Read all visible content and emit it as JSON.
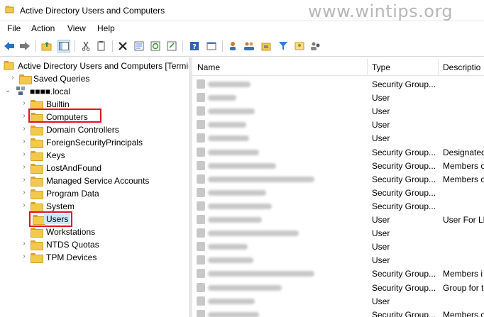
{
  "window": {
    "title": "Active Directory Users and Computers"
  },
  "watermark": "www.wintips.org",
  "menu": [
    "File",
    "Action",
    "View",
    "Help"
  ],
  "toolbar": {
    "icons": [
      "back-icon",
      "forward-icon",
      "up-folder-icon",
      "show-console-tree-icon",
      "cut-icon",
      "copy-icon",
      "delete-icon",
      "properties-icon",
      "refresh-icon",
      "export-list-icon",
      "help-icon",
      "mmc-console-icon",
      "new-user-icon",
      "new-group-icon",
      "new-ou-icon",
      "filter-icon",
      "add-to-group-icon",
      "delegate-control-icon"
    ]
  },
  "tree": {
    "root": "Active Directory Users and Computers [Termi",
    "saved_queries": "Saved Queries",
    "domain": "■■■■.local",
    "children": [
      {
        "label": "Builtin"
      },
      {
        "label": "Computers",
        "highlighted": true
      },
      {
        "label": "Domain Controllers"
      },
      {
        "label": "ForeignSecurityPrincipals"
      },
      {
        "label": "Keys"
      },
      {
        "label": "LostAndFound"
      },
      {
        "label": "Managed Service Accounts"
      },
      {
        "label": "Program Data"
      },
      {
        "label": "System"
      },
      {
        "label": "Users",
        "highlighted": true,
        "selected": true
      },
      {
        "label": "Workstations"
      },
      {
        "label": "NTDS Quotas"
      },
      {
        "label": "TPM Devices"
      }
    ]
  },
  "list": {
    "columns": [
      "Name",
      "Type",
      "Descriptio"
    ],
    "rows": [
      {
        "type": "Security Group...",
        "desc": ""
      },
      {
        "type": "User",
        "desc": ""
      },
      {
        "type": "User",
        "desc": ""
      },
      {
        "type": "User",
        "desc": ""
      },
      {
        "type": "User",
        "desc": ""
      },
      {
        "type": "Security Group...",
        "desc": "Designated"
      },
      {
        "type": "Security Group...",
        "desc": "Members o"
      },
      {
        "type": "Security Group...",
        "desc": "Members o"
      },
      {
        "type": "Security Group...",
        "desc": ""
      },
      {
        "type": "Security Group...",
        "desc": ""
      },
      {
        "type": "User",
        "desc": "User For LD"
      },
      {
        "type": "User",
        "desc": ""
      },
      {
        "type": "User",
        "desc": ""
      },
      {
        "type": "User",
        "desc": ""
      },
      {
        "type": "Security Group...",
        "desc": "Members i"
      },
      {
        "type": "Security Group...",
        "desc": "Group for t"
      },
      {
        "type": "User",
        "desc": ""
      },
      {
        "type": "Security Group...",
        "desc": "Members o"
      }
    ]
  },
  "colors": {
    "highlight_border": "#e0102a",
    "selection": "#cce8ff",
    "folder": "#f3c94b"
  }
}
